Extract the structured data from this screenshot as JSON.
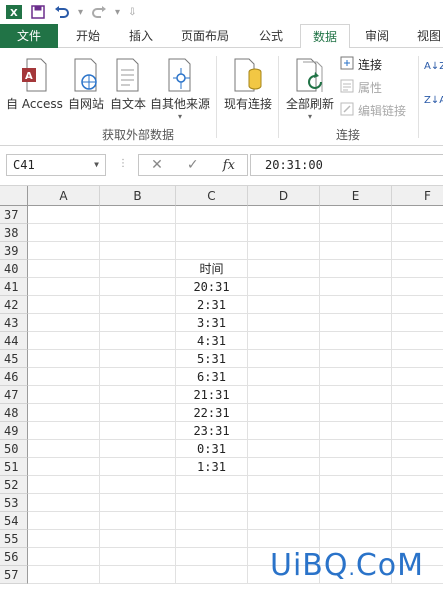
{
  "quick_access": {
    "excel_logo": "X",
    "customize": "⇩"
  },
  "tabs": [
    {
      "label": "文件"
    },
    {
      "label": "开始"
    },
    {
      "label": "插入"
    },
    {
      "label": "页面布局"
    },
    {
      "label": "公式"
    },
    {
      "label": "数据"
    },
    {
      "label": "审阅"
    },
    {
      "label": "视图"
    }
  ],
  "ribbon": {
    "external_group": {
      "label": "获取外部数据",
      "buttons": [
        {
          "label": "自 Access"
        },
        {
          "label": "自网站"
        },
        {
          "label": "自文本"
        },
        {
          "label": "自其他来源"
        }
      ]
    },
    "existing_connections": {
      "label": "现有连接"
    },
    "connections_group": {
      "label": "连接",
      "refresh_all": "全部刷新",
      "connections": "连接",
      "properties": "属性",
      "edit_links": "编辑链接"
    },
    "sort_az": "A↓Z",
    "sort_za": "Z↓A"
  },
  "formula_bar": {
    "name_box": "C41",
    "cancel": "✕",
    "enter": "✓",
    "fx": "fx",
    "value": "20:31:00"
  },
  "grid": {
    "columns": [
      "A",
      "B",
      "C",
      "D",
      "E",
      "F"
    ],
    "rows": [
      {
        "num": "37",
        "c": ""
      },
      {
        "num": "38",
        "c": ""
      },
      {
        "num": "39",
        "c": ""
      },
      {
        "num": "40",
        "c": "时间"
      },
      {
        "num": "41",
        "c": "20:31"
      },
      {
        "num": "42",
        "c": "2:31"
      },
      {
        "num": "43",
        "c": "3:31"
      },
      {
        "num": "44",
        "c": "4:31"
      },
      {
        "num": "45",
        "c": "5:31"
      },
      {
        "num": "46",
        "c": "6:31"
      },
      {
        "num": "47",
        "c": "21:31"
      },
      {
        "num": "48",
        "c": "22:31"
      },
      {
        "num": "49",
        "c": "23:31"
      },
      {
        "num": "50",
        "c": "0:31"
      },
      {
        "num": "51",
        "c": "1:31"
      },
      {
        "num": "52",
        "c": ""
      },
      {
        "num": "53",
        "c": ""
      },
      {
        "num": "54",
        "c": ""
      },
      {
        "num": "55",
        "c": ""
      },
      {
        "num": "56",
        "c": ""
      },
      {
        "num": "57",
        "c": ""
      }
    ]
  },
  "watermark": {
    "text": "UiBQ",
    "dot": ".",
    "suffix": "CoM"
  },
  "colors": {
    "excel_green": "#217346",
    "selection": "#217346",
    "watermark": "#2a73c9"
  }
}
